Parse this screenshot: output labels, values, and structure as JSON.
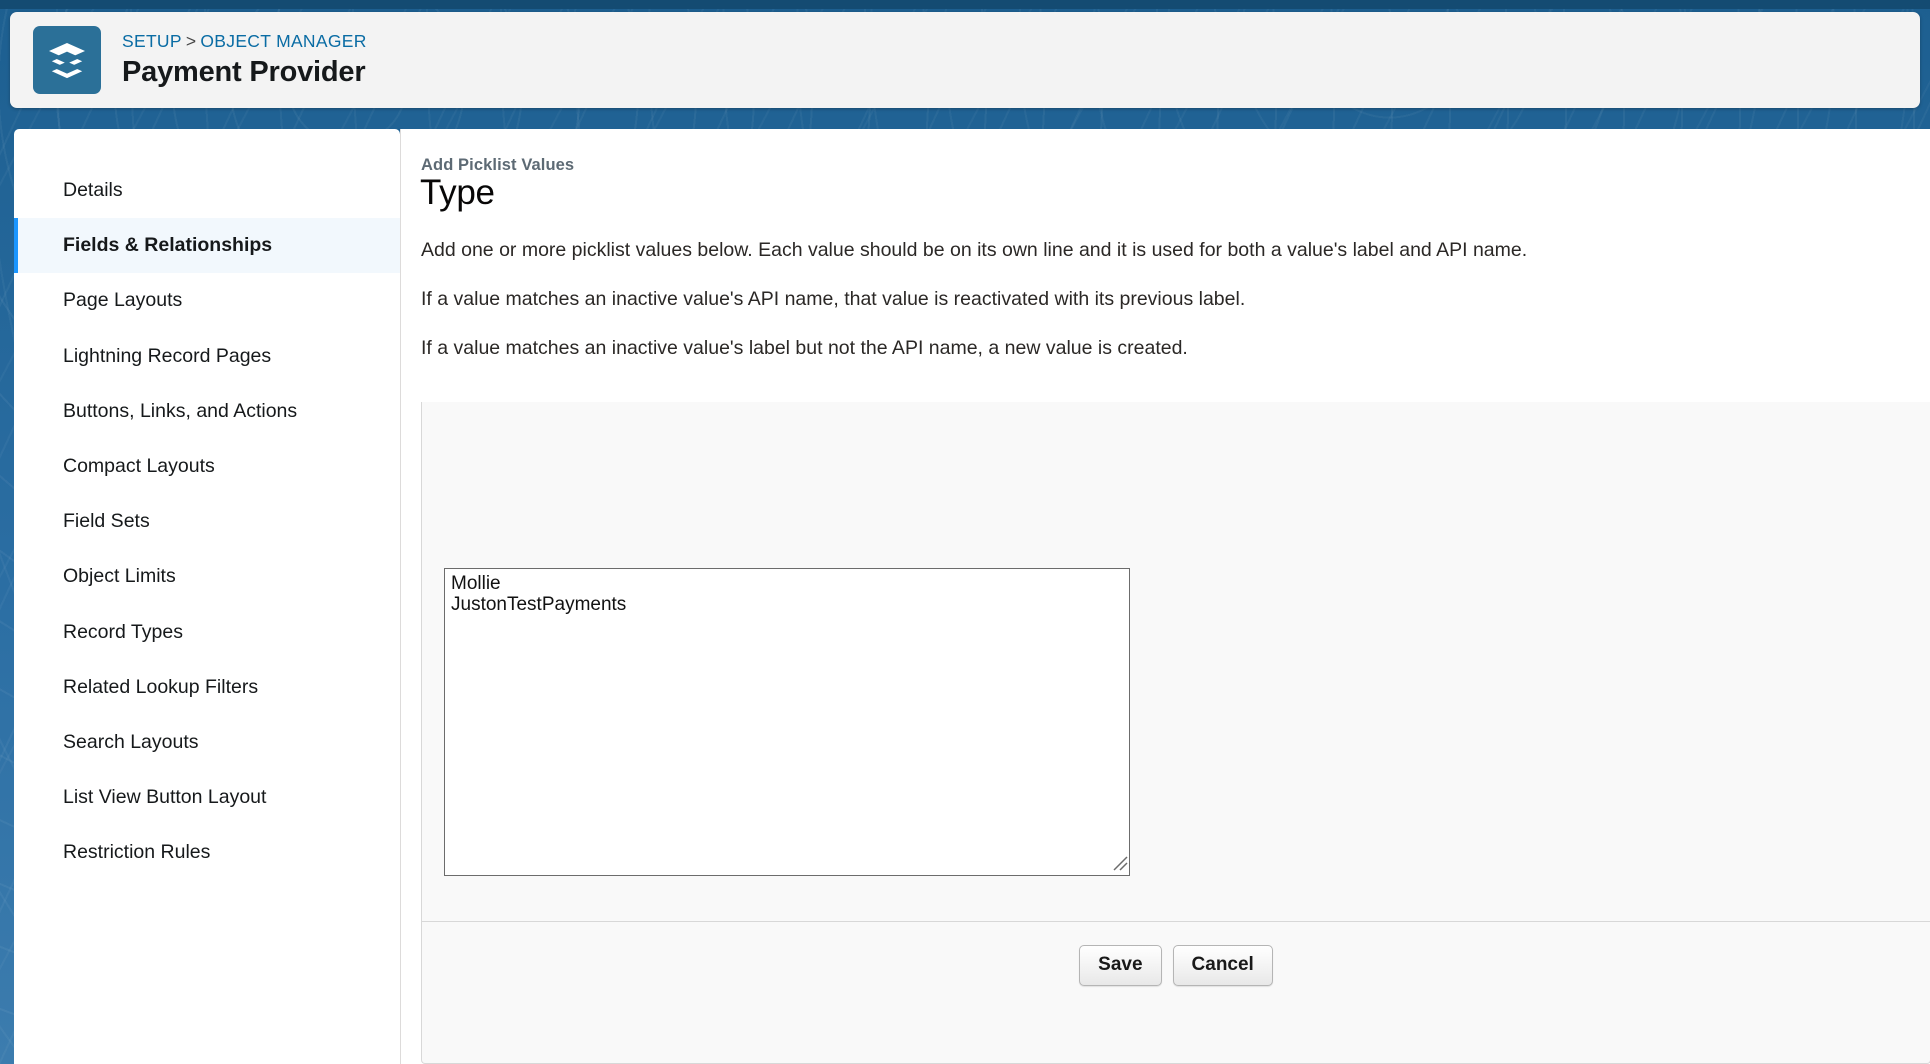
{
  "header": {
    "icon": "object-stack-icon",
    "icon_color": "#2b7098",
    "breadcrumb": {
      "setup": "SETUP",
      "separator": ">",
      "object_manager": "OBJECT MANAGER"
    },
    "title": "Payment Provider"
  },
  "sidebar": {
    "items": [
      {
        "label": "Details",
        "active": false
      },
      {
        "label": "Fields & Relationships",
        "active": true
      },
      {
        "label": "Page Layouts",
        "active": false
      },
      {
        "label": "Lightning Record Pages",
        "active": false
      },
      {
        "label": "Buttons, Links, and Actions",
        "active": false
      },
      {
        "label": "Compact Layouts",
        "active": false
      },
      {
        "label": "Field Sets",
        "active": false
      },
      {
        "label": "Object Limits",
        "active": false
      },
      {
        "label": "Record Types",
        "active": false
      },
      {
        "label": "Related Lookup Filters",
        "active": false
      },
      {
        "label": "Search Layouts",
        "active": false
      },
      {
        "label": "List View Button Layout",
        "active": false
      },
      {
        "label": "Restriction Rules",
        "active": false
      }
    ],
    "active_accent": "#1b96ff",
    "active_background": "#f2f8fd"
  },
  "main": {
    "eyebrow": "Add Picklist Values",
    "heading": "Type",
    "paragraphs": [
      "Add one or more picklist values below. Each value should be on its own line and it is used for both a value's label and API name.",
      "If a value matches an inactive value's API name, that value is reactivated with its previous label.",
      "If a value matches an inactive value's label but not the API name, a new value is created."
    ]
  },
  "form": {
    "top_bar_color": "#6b7a94",
    "picklist_values_textarea": {
      "value": "Mollie\nJustonTestPayments",
      "placeholder": ""
    },
    "buttons": {
      "save": "Save",
      "cancel": "Cancel"
    }
  }
}
